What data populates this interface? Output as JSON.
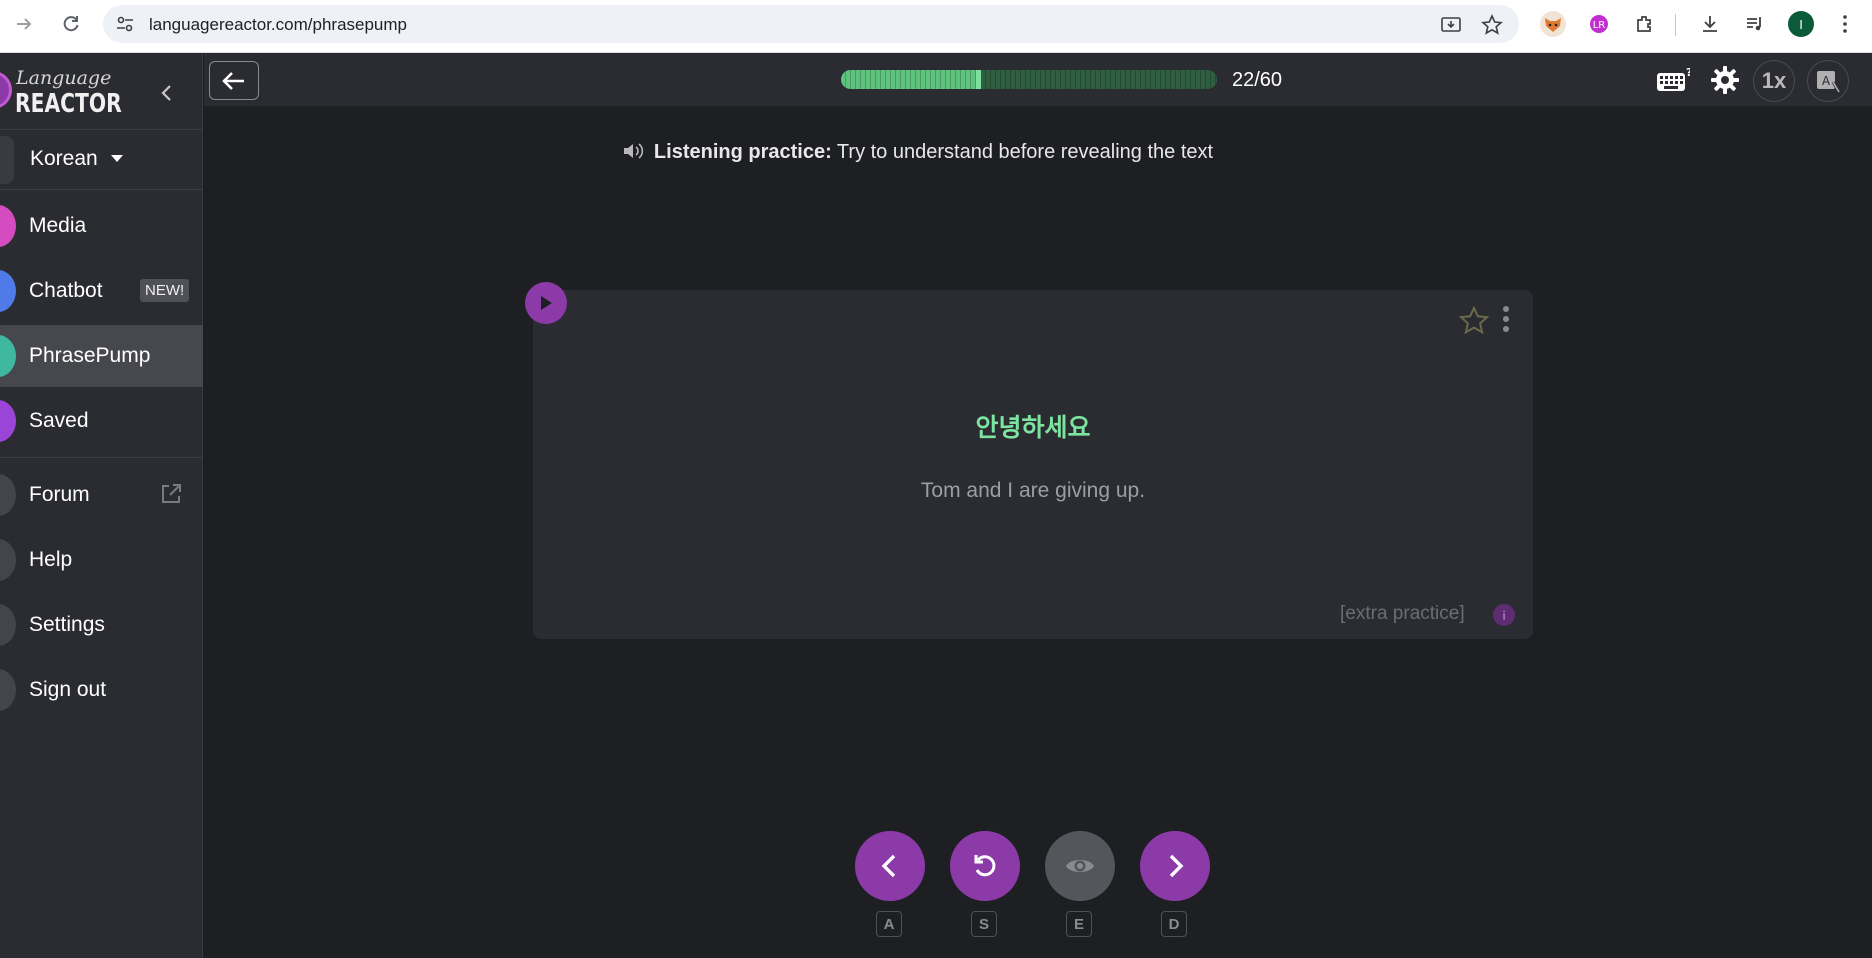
{
  "browser": {
    "url": "languagereactor.com/phrasepump",
    "profile_initial": "I"
  },
  "sidebar": {
    "logo_top": "Language",
    "logo_bottom": "REACTOR",
    "language": "Korean",
    "items": [
      {
        "label": "Media",
        "color": "#d44cc0"
      },
      {
        "label": "Chatbot",
        "color": "#4f7be8",
        "badge": "NEW!"
      },
      {
        "label": "PhrasePump",
        "color": "#3fb8a0",
        "active": true
      },
      {
        "label": "Saved",
        "color": "#9b45d8"
      },
      {
        "label": "Forum",
        "color": "#4a4b50"
      },
      {
        "label": "Help",
        "color": "#4a4b50"
      },
      {
        "label": "Settings",
        "color": "#4a4b50"
      },
      {
        "label": "Sign out",
        "color": "#4a4b50"
      }
    ]
  },
  "topbar": {
    "progress_current": 22,
    "progress_total": 60,
    "count_text": "22/60",
    "speed": "1x"
  },
  "hint": {
    "bold": "Listening practice:",
    "text": " Try to understand before revealing the text"
  },
  "card": {
    "phrase": "안녕하세요",
    "translation": "Tom and I are giving up.",
    "extra": "[extra practice]",
    "info": "i"
  },
  "controls": [
    {
      "name": "previous",
      "key": "A",
      "style": "purple"
    },
    {
      "name": "replay",
      "key": "S",
      "style": "purple"
    },
    {
      "name": "reveal",
      "key": "E",
      "style": "gray"
    },
    {
      "name": "next",
      "key": "D",
      "style": "purple"
    }
  ],
  "colors": {
    "accent": "#8b3aa8",
    "phrase": "#7ce3a0",
    "progress": "#5ec47d"
  }
}
